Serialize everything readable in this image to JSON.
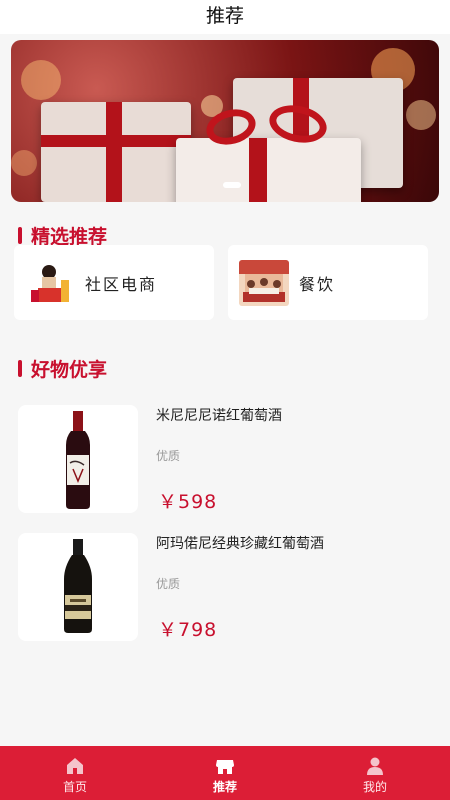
{
  "header": {
    "title": "推荐"
  },
  "banner": {
    "image_name": "gift-boxes-red-ribbon-banner"
  },
  "sections": {
    "featured_title": "精选推荐",
    "products_title": "好物优享"
  },
  "categories": [
    {
      "label": "社区电商",
      "icon": "community-ecommerce-thumbnail"
    },
    {
      "label": "餐饮",
      "icon": "dining-thumbnail"
    }
  ],
  "products": [
    {
      "name": "米尼尼尼诺红葡萄酒",
      "tag": "优质",
      "price": "￥598",
      "icon": "red-wine-bottle"
    },
    {
      "name": "阿玛偌尼经典珍藏红葡萄酒",
      "tag": "优质",
      "price": "￥798",
      "icon": "amarone-wine-bottle"
    }
  ],
  "tabbar": {
    "items": [
      {
        "label": "首页",
        "icon": "home-icon",
        "active": false
      },
      {
        "label": "推荐",
        "icon": "store-icon",
        "active": true
      },
      {
        "label": "我的",
        "icon": "user-icon",
        "active": false
      }
    ]
  },
  "colors": {
    "accent": "#c8102e",
    "tabbar": "#dc1e36",
    "background": "#f6f6f6"
  }
}
